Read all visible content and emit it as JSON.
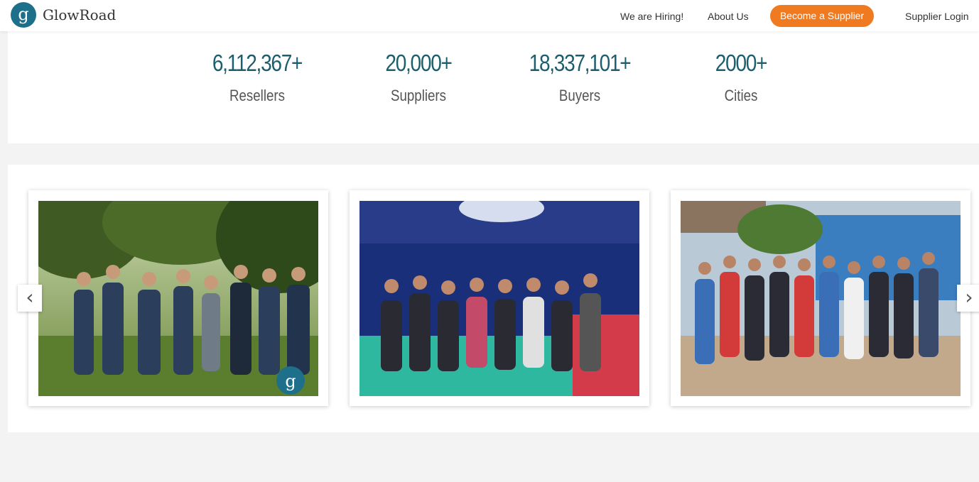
{
  "header": {
    "logo_letter": "g",
    "brand": "GlowRoad",
    "nav": {
      "hiring": "We are Hiring!",
      "about": "About Us",
      "become_supplier": "Become a Supplier",
      "supplier_login": "Supplier Login"
    }
  },
  "stats": [
    {
      "value": "6,112,367+",
      "label": "Resellers"
    },
    {
      "value": "20,000+",
      "label": "Suppliers"
    },
    {
      "value": "18,337,101+",
      "label": "Buyers"
    },
    {
      "value": "2000+",
      "label": "Cities"
    }
  ],
  "gallery": {
    "watermark_letter": "g",
    "prev_icon": "chevron-left-icon",
    "next_icon": "chevron-right-icon"
  },
  "colors": {
    "brand_teal": "#1d6f8a",
    "stat_teal": "#1b5f6e",
    "cta_orange": "#f07a1f"
  }
}
